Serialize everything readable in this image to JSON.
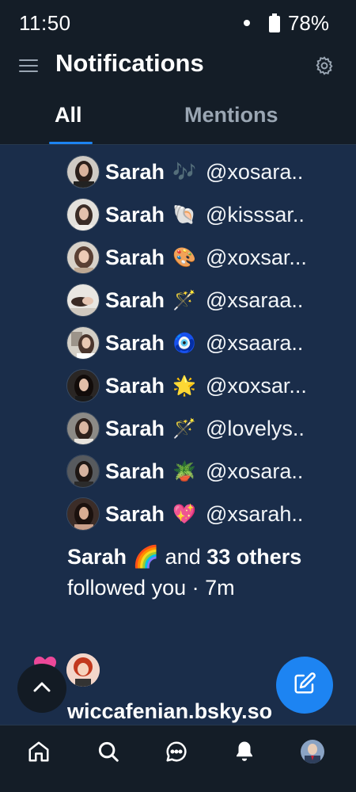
{
  "status_bar": {
    "time": "11:50",
    "battery": "78%"
  },
  "header": {
    "title": "Notifications"
  },
  "tabs": [
    {
      "label": "All",
      "selected": true
    },
    {
      "label": "Mentions",
      "selected": false
    }
  ],
  "followers": [
    {
      "name": "Sarah",
      "emoji": "🎶",
      "handle": "@xosara.."
    },
    {
      "name": "Sarah",
      "emoji": "🐚",
      "handle": "@kisssar.."
    },
    {
      "name": "Sarah",
      "emoji": "🎨",
      "handle": "@xoxsar..."
    },
    {
      "name": "Sarah",
      "emoji": "🪄",
      "handle": "@xsaraa.."
    },
    {
      "name": "Sarah",
      "emoji": "🧿",
      "handle": "@xsaara.."
    },
    {
      "name": "Sarah",
      "emoji": "🌟",
      "handle": "@xoxsar..."
    },
    {
      "name": "Sarah",
      "emoji": "🪄",
      "handle": "@lovelys.."
    },
    {
      "name": "Sarah",
      "emoji": "🪴",
      "handle": "@xosara.."
    },
    {
      "name": "Sarah",
      "emoji": "💖",
      "handle": "@xsarah.."
    }
  ],
  "summary": {
    "name": "Sarah 🌈",
    "and": " and ",
    "count": "33",
    "others": "others",
    "action": " followed you · 7m"
  },
  "next_notification": {
    "handle": "wiccafenian.bsky.so"
  },
  "colors": {
    "accent": "#1d84f2",
    "background": "#1a2d4a",
    "bar": "#141d27",
    "heart": "#ec4899"
  },
  "icons": {
    "menu": "hamburger-icon",
    "settings": "gear-icon",
    "scroll_top": "chevron-up-icon",
    "compose": "pencil-square-icon",
    "nav": [
      "home-icon",
      "search-icon",
      "chat-icon",
      "bell-icon",
      "profile-avatar"
    ]
  }
}
